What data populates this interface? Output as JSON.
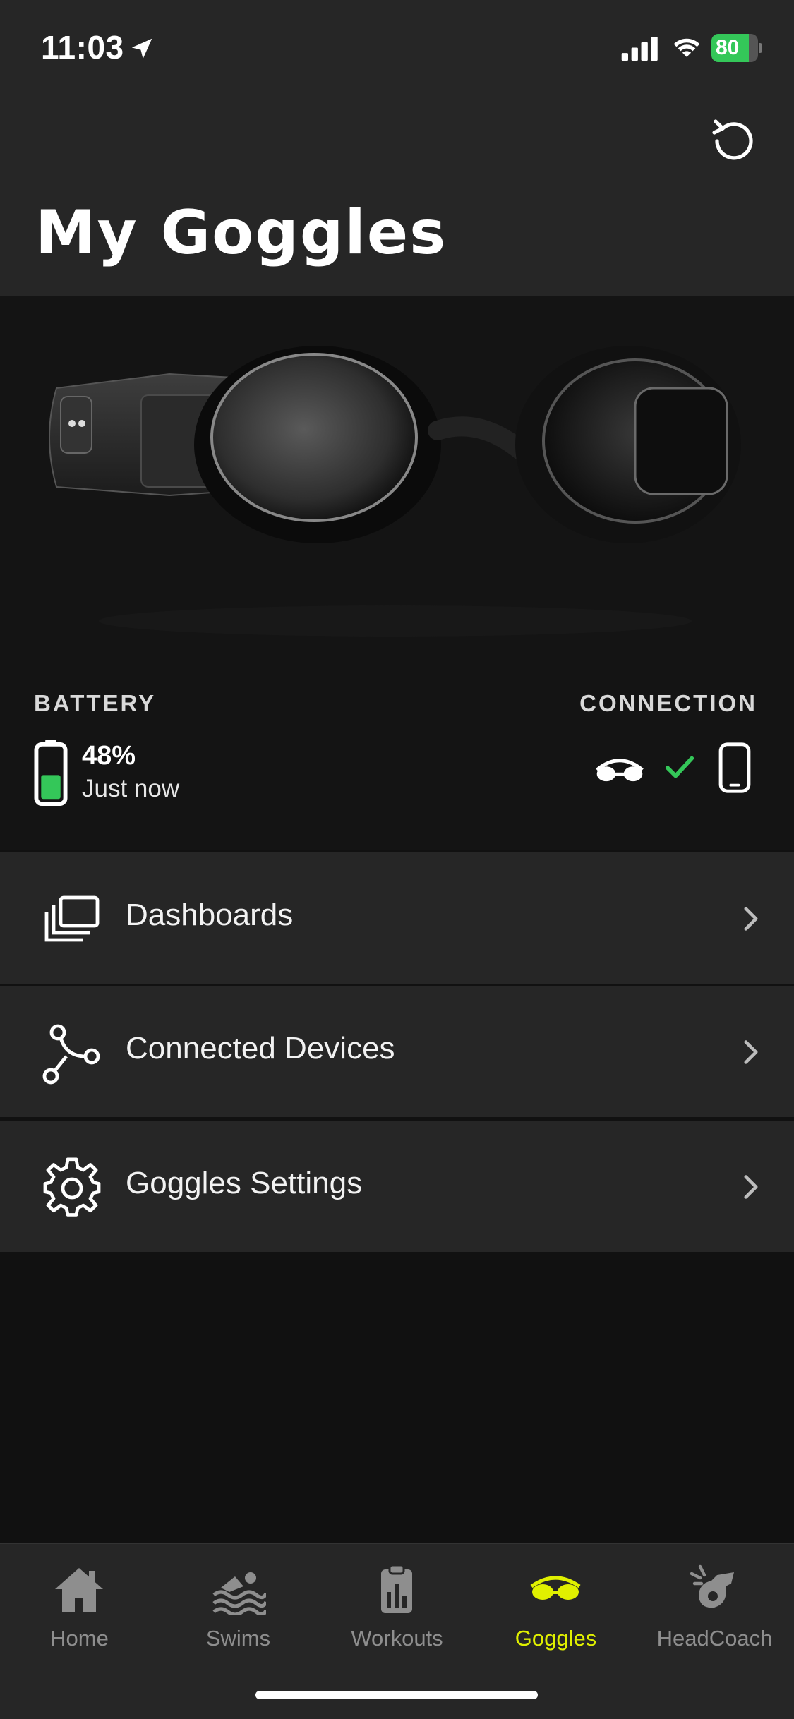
{
  "status_bar": {
    "time": "11:03",
    "battery_level": "80",
    "battery_fill_fraction": 0.8
  },
  "header": {
    "title": "My Goggles"
  },
  "device": {
    "battery_label": "BATTERY",
    "battery_percent": "48%",
    "battery_updated": "Just now",
    "battery_fill_fraction": 0.48,
    "connection_label": "CONNECTION",
    "connection_status_color": "#34c759"
  },
  "menu": {
    "items": [
      {
        "label": "Dashboards",
        "icon": "dashboards-icon"
      },
      {
        "label": "Connected Devices",
        "icon": "connected-devices-icon"
      },
      {
        "label": "Goggles Settings",
        "icon": "gear-icon"
      }
    ]
  },
  "tabs": [
    {
      "label": "Home",
      "icon": "home-icon",
      "active": false
    },
    {
      "label": "Swims",
      "icon": "swimmer-icon",
      "active": false
    },
    {
      "label": "Workouts",
      "icon": "clipboard-icon",
      "active": false
    },
    {
      "label": "Goggles",
      "icon": "goggles-icon",
      "active": true
    },
    {
      "label": "HeadCoach",
      "icon": "whistle-icon",
      "active": false
    }
  ],
  "colors": {
    "accent": "#e0f000",
    "battery_green": "#34c759",
    "background": "#111111",
    "surface": "#262626"
  }
}
